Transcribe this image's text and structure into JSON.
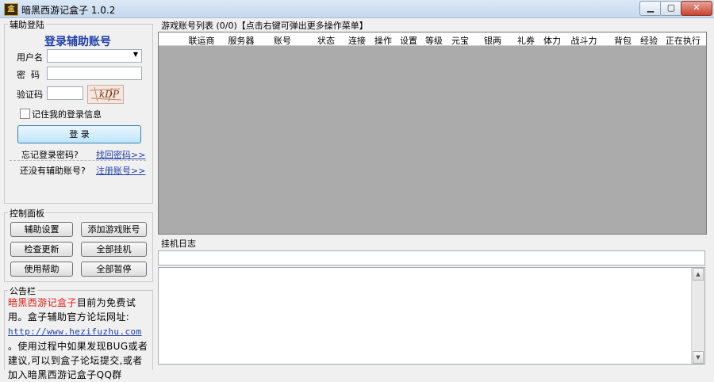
{
  "window": {
    "title": "暗黑西游记盒子 1.0.2",
    "icon_label": "盒",
    "min_label": "▁",
    "max_label": "▢",
    "close_label": "✕"
  },
  "login": {
    "group_title": "辅助登陆",
    "heading": "登录辅助账号",
    "username_label": "用户名",
    "password_label": "密  码",
    "captcha_label": "验证码",
    "captcha_text": "kDP",
    "remember_label": "记住我的登录信息",
    "login_button": "登  录",
    "forgot_text": "忘记登录密码?",
    "forgot_link": "找回密码>>",
    "noaccount_text": "还没有辅助账号?",
    "register_link": "注册账号>>"
  },
  "control": {
    "group_title": "控制面板",
    "buttons": [
      "辅助设置",
      "添加游戏账号",
      "检查更新",
      "全部挂机",
      "使用帮助",
      "全部暂停"
    ]
  },
  "notice": {
    "group_title": "公告栏",
    "highlight": "暗黑西游记盒子",
    "text1": "目前为免费试用。盒子辅助官方论坛网址:",
    "url": "http://www.hezifuzhu.com",
    "text2": "。使用过程中如果发现BUG或者建议,可以到盒子论坛提交,或者加入暗黑西游记盒子QQ群"
  },
  "accounts": {
    "title": "游戏账号列表 (0/0)【点击右键可弹出更多操作菜单】",
    "columns": [
      "联运商",
      "服务器",
      "账号",
      "状态",
      "连接",
      "操作",
      "设置",
      "等级",
      "元宝",
      "银两",
      "礼券",
      "体力",
      "战斗力",
      "背包",
      "经验",
      "正在执行"
    ]
  },
  "log": {
    "title": "挂机日志",
    "up_arrow": "▲",
    "down_arrow": "▼"
  },
  "colors": {
    "accent": "#1f3ea8",
    "highlight": "#e0201a",
    "grid_bg": "#ababab"
  }
}
